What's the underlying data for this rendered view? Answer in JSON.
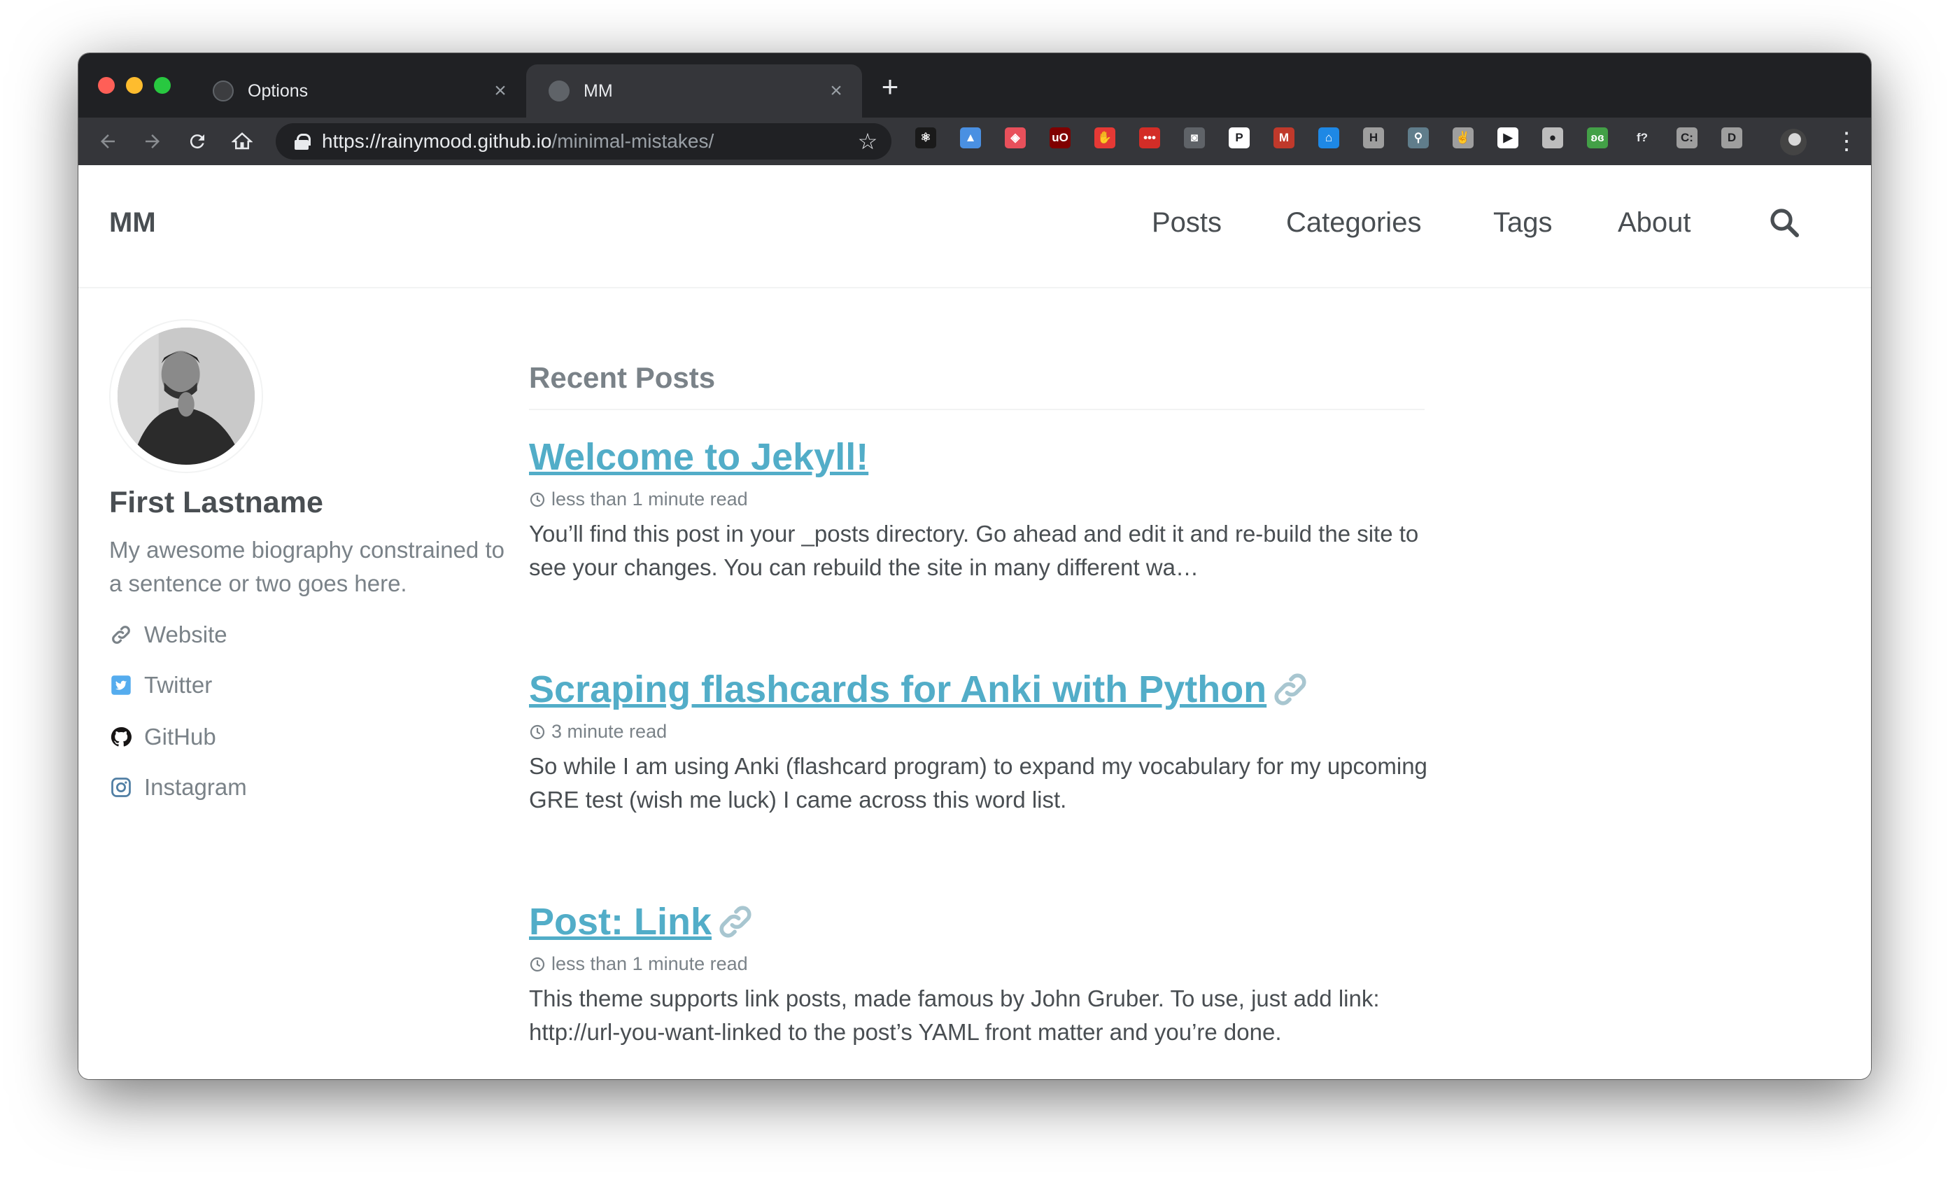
{
  "browser": {
    "tabs": [
      {
        "title": "Options",
        "active": false
      },
      {
        "title": "MM",
        "active": true
      }
    ],
    "close_glyph": "×",
    "new_tab_glyph": "+",
    "url_host": "https://rainymood.github.io",
    "url_path": "/minimal-mistakes/",
    "extension_icons": [
      {
        "name": "react-devtools-icon",
        "color": "#1a1a1a",
        "label": "⚛"
      },
      {
        "name": "cap-icon",
        "color": "#4a90e2",
        "label": "▲"
      },
      {
        "name": "shield-icon",
        "color": "#e8505b",
        "label": "◈"
      },
      {
        "name": "ublock-icon",
        "color": "#800000",
        "label": "uO"
      },
      {
        "name": "stop-hand-icon",
        "color": "#e53935",
        "label": "✋"
      },
      {
        "name": "lastpass-icon",
        "color": "#d32d27",
        "label": "•••"
      },
      {
        "name": "camera-icon",
        "color": "#5f6368",
        "label": "◙"
      },
      {
        "name": "p-icon",
        "color": "#ffffff",
        "label": "P"
      },
      {
        "name": "mendeley-icon",
        "color": "#c0392b",
        "label": "M"
      },
      {
        "name": "museum-icon",
        "color": "#1e88e5",
        "label": "⌂"
      },
      {
        "name": "h-icon",
        "color": "#9e9e9e",
        "label": "H"
      },
      {
        "name": "search-ext-icon",
        "color": "#607d8b",
        "label": "⚲"
      },
      {
        "name": "hand-ext-icon",
        "color": "#9e9e9e",
        "label": "✌"
      },
      {
        "name": "play-icon",
        "color": "#ffffff",
        "label": "▶"
      },
      {
        "name": "circle-icon",
        "color": "#bdbdbd",
        "label": "●"
      },
      {
        "name": "butterfly-icon",
        "color": "#43a047",
        "label": "ʚɞ"
      },
      {
        "name": "function-icon",
        "color": "#35363a",
        "label": "f?"
      },
      {
        "name": "c-icon",
        "color": "#9e9e9e",
        "label": "C:"
      },
      {
        "name": "d-icon",
        "color": "#9e9e9e",
        "label": "D"
      }
    ]
  },
  "site": {
    "title": "MM",
    "nav": [
      "Posts",
      "Categories",
      "Tags",
      "About"
    ]
  },
  "author": {
    "name": "First Lastname",
    "bio": "My awesome biography constrained to a sentence or two goes here.",
    "links": [
      {
        "label": "Website",
        "icon": "link-icon"
      },
      {
        "label": "Twitter",
        "icon": "twitter-icon"
      },
      {
        "label": "GitHub",
        "icon": "github-icon"
      },
      {
        "label": "Instagram",
        "icon": "instagram-icon"
      }
    ]
  },
  "main": {
    "section_title": "Recent Posts",
    "posts": [
      {
        "title": "Welcome to Jekyll!",
        "meta": "less than 1 minute read",
        "excerpt": "You’ll find this post in your _posts directory. Go ahead and edit it and re-build the site to see your changes. You can rebuild the site in many different wa…",
        "is_link_post": false
      },
      {
        "title": "Scraping flashcards for Anki with Python",
        "meta": "3 minute read",
        "excerpt": "So while I am using Anki (flashcard program) to expand my vocabulary for my upcoming GRE test (wish me luck) I came across this word list.",
        "is_link_post": true
      },
      {
        "title": "Post: Link",
        "meta": "less than 1 minute read",
        "excerpt": "This theme supports link posts, made famous by John Gruber. To use, just add link: http://url-you-want-linked to the post’s YAML front matter and you’re done.",
        "is_link_post": true
      }
    ]
  },
  "colors": {
    "accent": "#52adc8",
    "text": "#494e52",
    "muted": "#7a8288"
  }
}
